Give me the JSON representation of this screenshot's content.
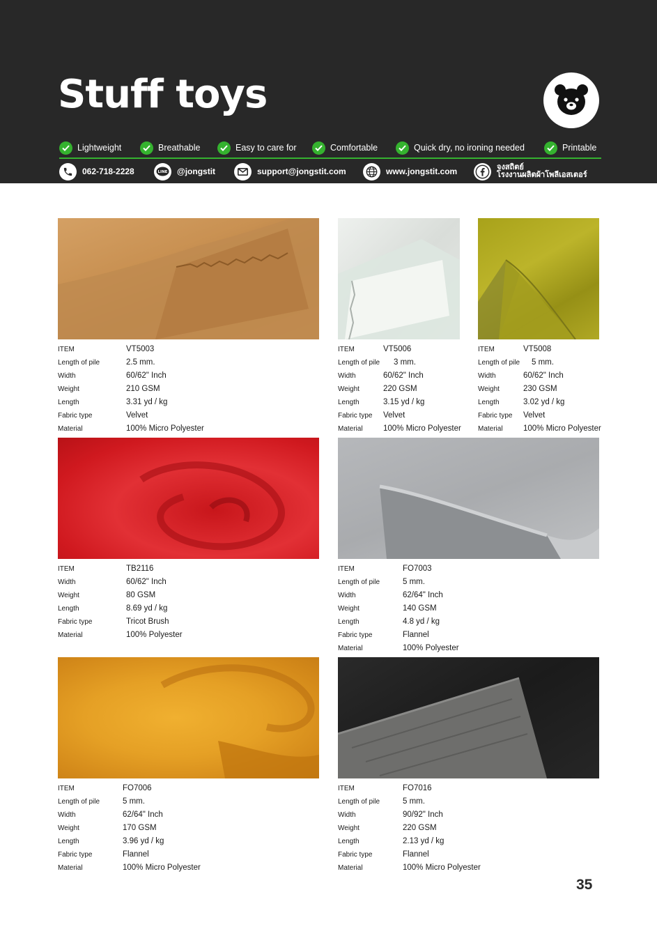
{
  "header": {
    "title": "Stuff toys",
    "features": [
      "Lightweight",
      "Breathable",
      "Easy to care for",
      "Comfortable",
      "Quick dry, no ironing needed",
      "Printable"
    ],
    "contacts": {
      "phone": "062-718-2228",
      "line": "@jongstit",
      "line_badge": "LINE",
      "email": "support@jongstit.com",
      "web": "www.jongstit.com",
      "facebook_line1": "จงสถิตย์",
      "facebook_line2": "โรงงานผลิตผ้าโพลีเอสเตอร์"
    },
    "colors": {
      "background": "#282828",
      "accent": "#35b22f"
    }
  },
  "products": [
    {
      "id": "vt5003",
      "specs": [
        [
          "ITEM",
          "VT5003"
        ],
        [
          "Length of pile",
          "2.5 mm."
        ],
        [
          "Width",
          "60/62\" Inch"
        ],
        [
          "Weight",
          "210 GSM"
        ],
        [
          "Length",
          "3.31 yd / kg"
        ],
        [
          "Fabric type",
          "Velvet"
        ],
        [
          "Material",
          "100% Micro Polyester"
        ]
      ]
    },
    {
      "id": "vt5006",
      "specs": [
        [
          "ITEM",
          "VT5006"
        ],
        [
          "Length of pile",
          "3 mm."
        ],
        [
          "Width",
          "60/62\" Inch"
        ],
        [
          "Weight",
          "220 GSM"
        ],
        [
          "Length",
          "3.15 yd / kg"
        ],
        [
          "Fabric type",
          "Velvet"
        ],
        [
          "Material",
          "100% Micro Polyester"
        ]
      ]
    },
    {
      "id": "vt5008",
      "specs": [
        [
          "ITEM",
          "VT5008"
        ],
        [
          "Length of pile",
          "5 mm."
        ],
        [
          "Width",
          "60/62\" Inch"
        ],
        [
          "Weight",
          "230 GSM"
        ],
        [
          "Length",
          "3.02 yd / kg"
        ],
        [
          "Fabric type",
          "Velvet"
        ],
        [
          "Material",
          "100% Micro Polyester"
        ]
      ]
    },
    {
      "id": "tb2116",
      "specs": [
        [
          "ITEM",
          "TB2116"
        ],
        [
          "Width",
          "60/62\" Inch"
        ],
        [
          "Weight",
          "80 GSM"
        ],
        [
          "Length",
          "8.69 yd / kg"
        ],
        [
          "Fabric type",
          "Tricot Brush"
        ],
        [
          "Material",
          "100% Polyester"
        ]
      ]
    },
    {
      "id": "fo7003",
      "specs": [
        [
          "ITEM",
          "FO7003"
        ],
        [
          "Length of pile",
          "5 mm."
        ],
        [
          "Width",
          "62/64\" Inch"
        ],
        [
          "Weight",
          "140 GSM"
        ],
        [
          "Length",
          "4.8 yd / kg"
        ],
        [
          "Fabric type",
          "Flannel"
        ],
        [
          "Material",
          "100% Polyester"
        ]
      ]
    },
    {
      "id": "fo7006",
      "specs": [
        [
          "ITEM",
          "FO7006"
        ],
        [
          "Length of pile",
          "5 mm."
        ],
        [
          "Width",
          "62/64\" Inch"
        ],
        [
          "Weight",
          "170 GSM"
        ],
        [
          "Length",
          "3.96 yd / kg"
        ],
        [
          "Fabric type",
          "Flannel"
        ],
        [
          "Material",
          "100% Micro Polyester"
        ]
      ]
    },
    {
      "id": "fo7016",
      "specs": [
        [
          "ITEM",
          "FO7016"
        ],
        [
          "Length of pile",
          "5 mm."
        ],
        [
          "Width",
          "90/92\" Inch"
        ],
        [
          "Weight",
          "220 GSM"
        ],
        [
          "Length",
          "2.13 yd / kg"
        ],
        [
          "Fabric type",
          "Flannel"
        ],
        [
          "Material",
          "100% Micro Polyester"
        ]
      ]
    }
  ],
  "page_number": "35"
}
